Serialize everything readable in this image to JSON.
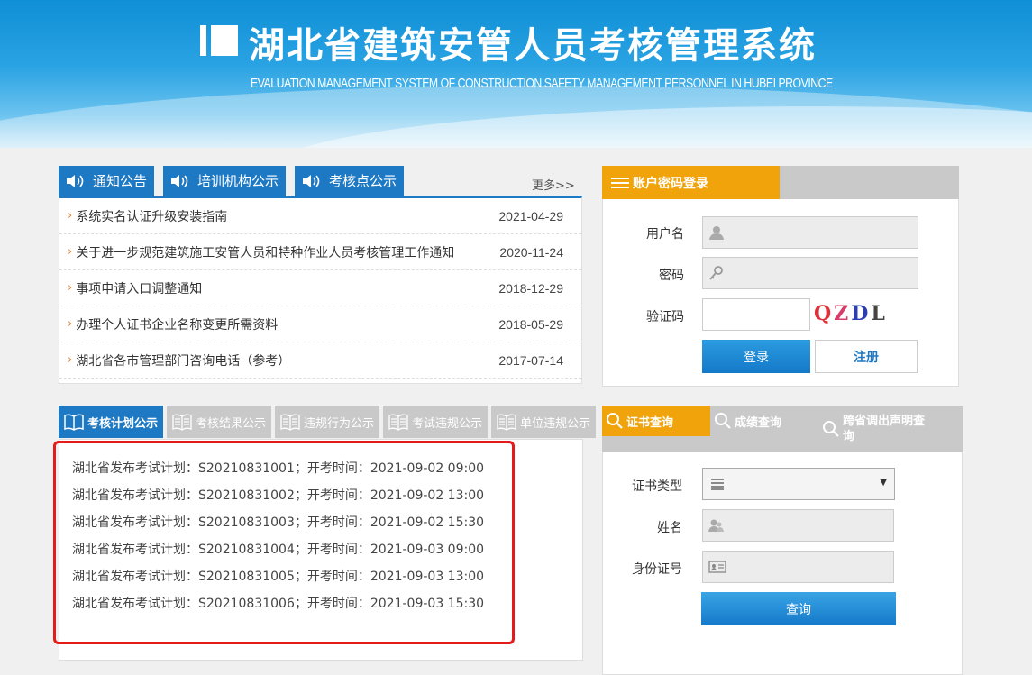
{
  "banner": {
    "title": "湖北省建筑安管人员考核管理系统",
    "subtitle": "EVALUATION MANAGEMENT SYSTEM OF CONSTRUCTION SAFETY MANAGEMENT PERSONNEL IN HUBEI PROVINCE"
  },
  "notice": {
    "tabs": [
      {
        "label": "通知公告",
        "icon": "speaker-icon"
      },
      {
        "label": "培训机构公示",
        "icon": "speaker-icon"
      },
      {
        "label": "考核点公示",
        "icon": "speaker-icon"
      }
    ],
    "more": "更多>>",
    "items": [
      {
        "title": "系统实名认证升级安装指南",
        "date": "2021-04-29"
      },
      {
        "title": "关于进一步规范建筑施工安管人员和特种作业人员考核管理工作通知",
        "date": "2020-11-24"
      },
      {
        "title": "事项申请入口调整通知",
        "date": "2018-12-29"
      },
      {
        "title": "办理个人证书企业名称变更所需资料",
        "date": "2018-05-29"
      },
      {
        "title": "湖北省各市管理部门咨询电话（参考）",
        "date": "2017-07-14"
      }
    ]
  },
  "exam": {
    "tabs": [
      {
        "label": "考核计划公示",
        "active": true
      },
      {
        "label": "考核结果公示",
        "active": false
      },
      {
        "label": "违规行为公示",
        "active": false
      },
      {
        "label": "考试违规公示",
        "active": false
      },
      {
        "label": "单位违规公示",
        "active": false
      }
    ],
    "plans": [
      "湖北省发布考试计划：S20210831001；开考时间：2021-09-02 09:00",
      "湖北省发布考试计划：S20210831002；开考时间：2021-09-02 13:00",
      "湖北省发布考试计划：S20210831003；开考时间：2021-09-02 15:30",
      "湖北省发布考试计划：S20210831004；开考时间：2021-09-03 09:00",
      "湖北省发布考试计划：S20210831005；开考时间：2021-09-03 13:00",
      "湖北省发布考试计划：S20210831006；开考时间：2021-09-03 15:30"
    ]
  },
  "login": {
    "tab": "账户密码登录",
    "username_label": "用户名",
    "password_label": "密码",
    "captcha_label": "验证码",
    "captcha_text": "QZDL",
    "login_button": "登录",
    "register_button": "注册"
  },
  "cert": {
    "tabs": [
      "证书查询",
      "成绩查询",
      "跨省调出声明查询"
    ],
    "type_label": "证书类型",
    "name_label": "姓名",
    "id_label": "身份证号",
    "select_value": "",
    "query_button": "查询"
  },
  "colors": {
    "primary": "#1e79c4",
    "accent": "#f0a30a",
    "highlight": "#e41b1b"
  }
}
